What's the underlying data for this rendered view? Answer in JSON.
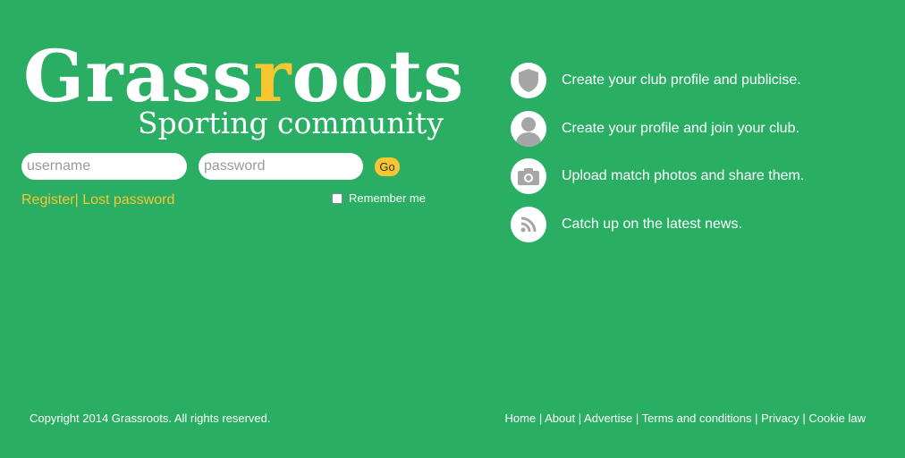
{
  "logo": {
    "title_before": "Grass",
    "title_accent": "r",
    "title_after": "oots",
    "subtitle": "Sporting community"
  },
  "login": {
    "username_placeholder": "username",
    "password_placeholder": "password",
    "go_label": "Go",
    "register_label": "Register",
    "separator": "|",
    "lost_password_label": "Lost password",
    "remember_label": "Remember me",
    "remember_checked": false
  },
  "features": [
    {
      "icon": "shield-icon",
      "text": "Create your club profile and publicise."
    },
    {
      "icon": "user-icon",
      "text": "Create your profile and join your club."
    },
    {
      "icon": "camera-icon",
      "text": "Upload match photos and share them."
    },
    {
      "icon": "rss-icon",
      "text": "Catch up on the latest news."
    }
  ],
  "footer": {
    "copyright": "Copyright 2014 Grassroots. All rights reserved.",
    "links": [
      "Home",
      "About",
      "Advertise",
      "Terms and conditions",
      "Privacy",
      "Cookie law"
    ],
    "separator": "|"
  },
  "colors": {
    "background": "#29ae63",
    "accent": "#f7c631",
    "icon_grey": "#a6a6a6"
  }
}
